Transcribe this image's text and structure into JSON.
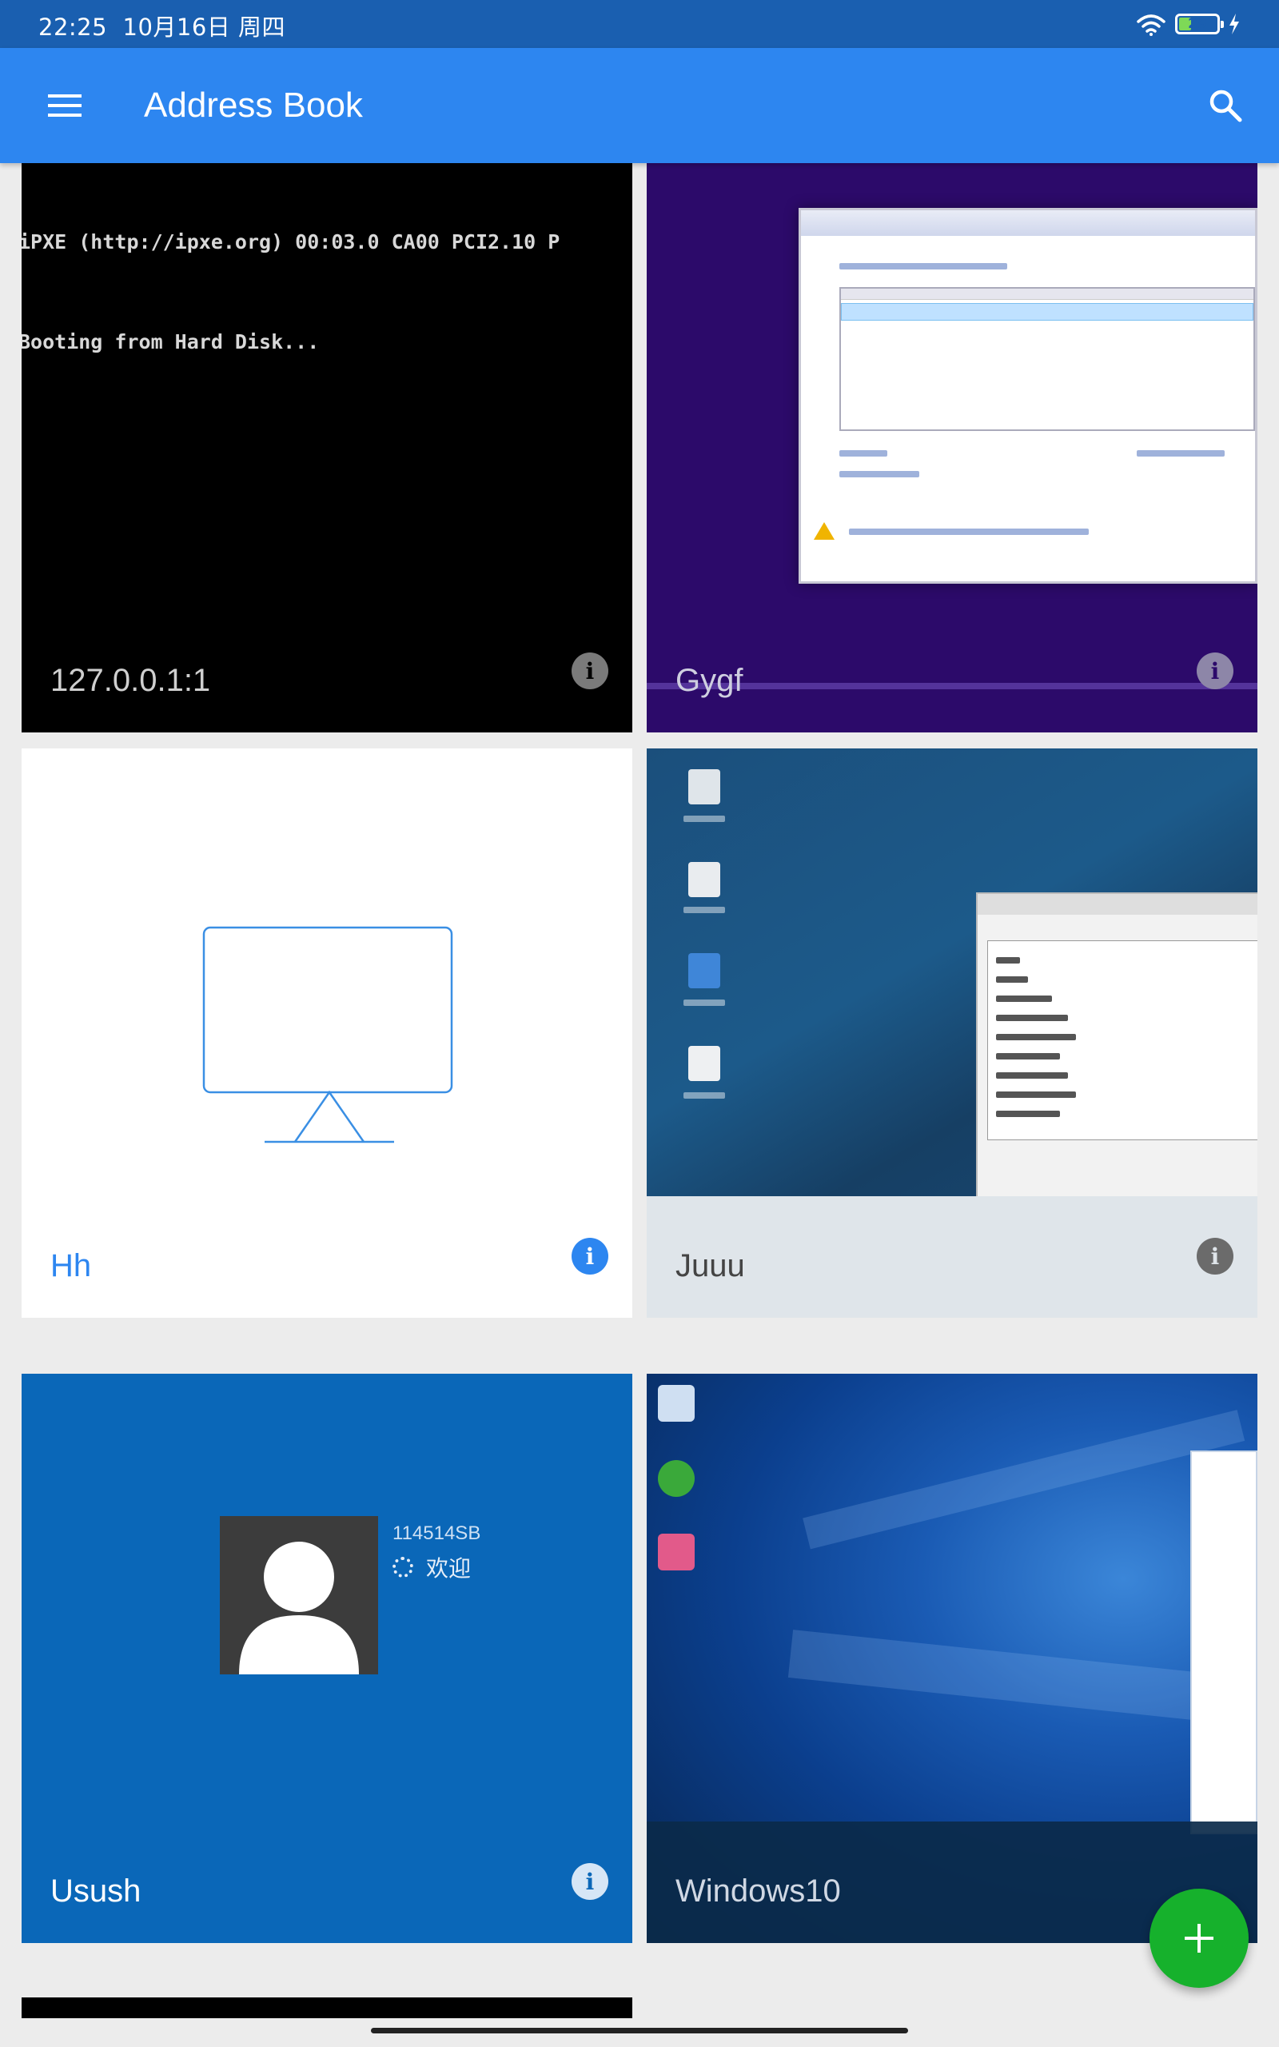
{
  "status_bar": {
    "time": "22:25",
    "date": "10月16日 周四",
    "battery_level": "29",
    "battery_fraction": 0.29,
    "wifi_icon": "wifi-icon",
    "charging_icon": "charging-icon"
  },
  "app_bar": {
    "title": "Address Book",
    "menu_icon": "menu-icon",
    "search_icon": "search-icon",
    "color": "#2d86f0"
  },
  "connections": [
    {
      "name": "127.0.0.1:1",
      "thumbnail": "boot-console"
    },
    {
      "name": "Gygf",
      "thumbnail": "windows-setup"
    },
    {
      "name": "Hh",
      "thumbnail": "placeholder"
    },
    {
      "name": "Juuu",
      "thumbnail": "linux-desktop"
    },
    {
      "name": "Usush",
      "thumbnail": "windows-login"
    },
    {
      "name": "Windows10",
      "thumbnail": "windows10-desktop"
    }
  ],
  "console": {
    "line1": "iPXE (http://ipxe.org) 00:03.0 CA00 PCI2.10 P",
    "line2": "Booting from Hard Disk..."
  },
  "login": {
    "username": "114514SB",
    "status": "欢迎"
  },
  "fab": {
    "icon": "plus-icon",
    "color": "#16b12c"
  }
}
